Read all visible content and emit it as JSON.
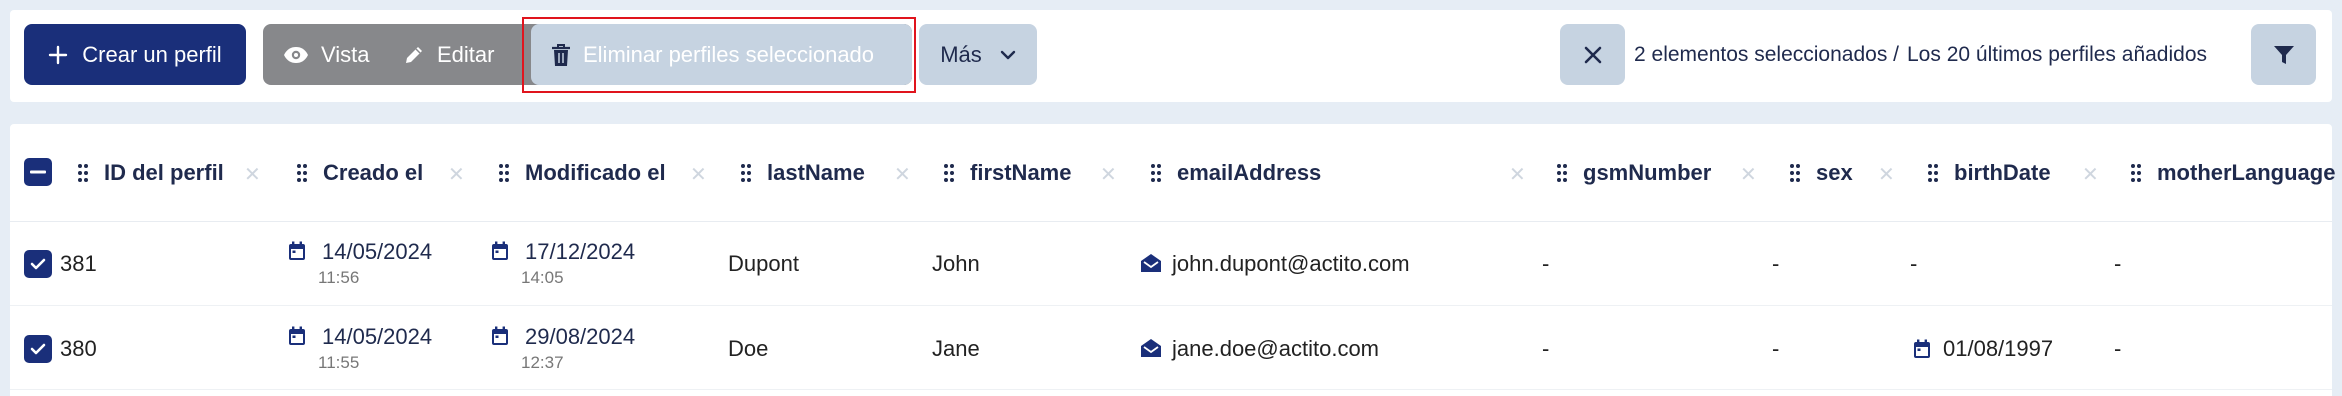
{
  "toolbar": {
    "create_label": "Crear un perfil",
    "view_label": "Vista",
    "edit_label": "Editar",
    "delete_label": "Eliminar perfiles seleccionado",
    "more_label": "Más",
    "selection_count": "2 elementos seleccionados /",
    "selection_scope": "Los 20 últimos perfiles añadidos"
  },
  "table": {
    "columns": [
      "ID del perfil",
      "Creado el",
      "Modificado el",
      "lastName",
      "firstName",
      "emailAddress",
      "gsmNumber",
      "sex",
      "birthDate",
      "motherLanguage"
    ],
    "rows": [
      {
        "id": "381",
        "created_date": "14/05/2024",
        "created_time": "11:56",
        "modified_date": "17/12/2024",
        "modified_time": "14:05",
        "lastName": "Dupont",
        "firstName": "John",
        "email": "john.dupont@actito.com",
        "gsm": "-",
        "sex": "-",
        "birthDate": "-",
        "motherLanguage": "-"
      },
      {
        "id": "380",
        "created_date": "14/05/2024",
        "created_time": "11:55",
        "modified_date": "29/08/2024",
        "modified_time": "12:37",
        "lastName": "Doe",
        "firstName": "Jane",
        "email": "jane.doe@actito.com",
        "gsm": "-",
        "sex": "-",
        "birthDate": "01/08/1997",
        "motherLanguage": "-"
      }
    ]
  },
  "colors": {
    "primary": "#1a2f7a",
    "secondary_button": "#c6d3e1",
    "disabled_group": "#87888b",
    "highlight_border": "#e0141d"
  }
}
